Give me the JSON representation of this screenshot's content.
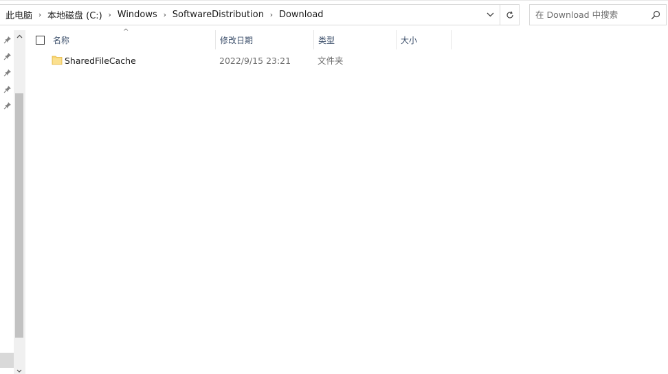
{
  "address_bar": {
    "breadcrumbs": [
      "此电脑",
      "本地磁盘 (C:)",
      "Windows",
      "SoftwareDistribution",
      "Download"
    ],
    "separator": "›",
    "dropdown_icon": "chevron-down-icon",
    "refresh_icon": "refresh-icon"
  },
  "search": {
    "placeholder": "在 Download 中搜索",
    "icon": "search-icon"
  },
  "navigation_pane": {
    "pinned_icons": [
      "pin-icon",
      "pin-icon",
      "pin-icon",
      "pin-icon",
      "pin-icon"
    ]
  },
  "columns": {
    "name": "名称",
    "date_modified": "修改日期",
    "type": "类型",
    "size": "大小",
    "sort_indicator": "^"
  },
  "files": [
    {
      "name": "SharedFileCache",
      "date_modified": "2022/9/15 23:21",
      "type": "文件夹",
      "size": "",
      "icon": "folder-icon"
    }
  ],
  "colors": {
    "folder": "#f8d775",
    "folder_edge": "#e2b33c",
    "header_text": "#3c4f6b",
    "scrollbar_thumb": "#c2c2c2"
  }
}
